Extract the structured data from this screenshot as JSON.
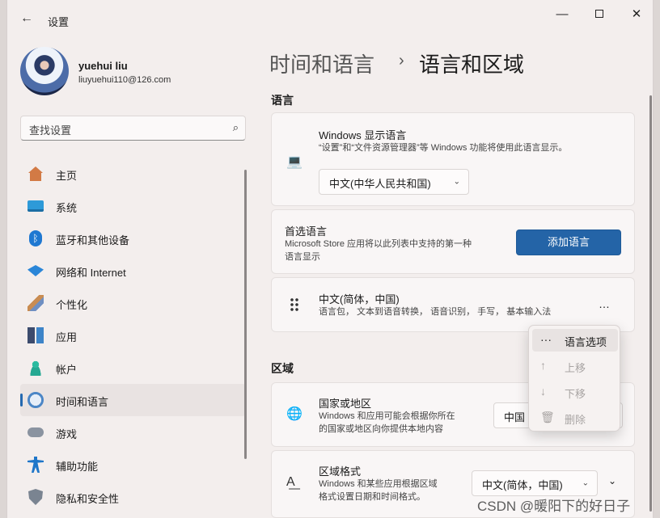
{
  "window": {
    "title": "设置",
    "back_icon": "back-arrow-icon"
  },
  "user": {
    "name": "yuehui liu",
    "email": "liuyuehui110@126.com"
  },
  "search": {
    "placeholder": "查找设置"
  },
  "nav": [
    {
      "label": "主页",
      "icon": "home-icon"
    },
    {
      "label": "系统",
      "icon": "system-icon"
    },
    {
      "label": "蓝牙和其他设备",
      "icon": "bluetooth-icon"
    },
    {
      "label": "网络和 Internet",
      "icon": "wifi-icon"
    },
    {
      "label": "个性化",
      "icon": "brush-icon"
    },
    {
      "label": "应用",
      "icon": "apps-icon"
    },
    {
      "label": "帐户",
      "icon": "account-icon"
    },
    {
      "label": "时间和语言",
      "icon": "time-language-icon",
      "active": true
    },
    {
      "label": "游戏",
      "icon": "gamepad-icon"
    },
    {
      "label": "辅助功能",
      "icon": "accessibility-icon"
    },
    {
      "label": "隐私和安全性",
      "icon": "shield-icon"
    }
  ],
  "breadcrumb": {
    "parent": "时间和语言",
    "separator": "›",
    "current": "语言和区域"
  },
  "language_section": {
    "heading": "语言",
    "display_language": {
      "title": "Windows 显示语言",
      "desc": "“设置”和“文件资源管理器”等 Windows 功能将使用此语言显示。",
      "value": "中文(中华人民共和国)"
    },
    "preferred": {
      "title": "首选语言",
      "desc_line1": "Microsoft Store 应用将以此列表中支持的第一种",
      "desc_line2": "语言显示",
      "button": "添加语言"
    },
    "language_item": {
      "title": "中文(简体，中国)",
      "desc": "语言包， 文本到语音转换， 语音识别， 手写， 基本输入法",
      "more": "…"
    }
  },
  "context_menu": {
    "items": [
      {
        "label": "语言选项",
        "icon": "ellipsis-icon",
        "glyph": "···"
      },
      {
        "label": "上移",
        "icon": "arrow-up-icon",
        "glyph": "↑"
      },
      {
        "label": "下移",
        "icon": "arrow-down-icon",
        "glyph": "↓"
      },
      {
        "label": "删除",
        "icon": "trash-icon",
        "glyph": "🗑"
      }
    ]
  },
  "region_section": {
    "heading": "区域",
    "country": {
      "title": "国家或地区",
      "desc_line1": "Windows 和应用可能会根据你所在",
      "desc_line2": "的国家或地区向你提供本地内容",
      "value": "中国"
    },
    "format": {
      "title": "区域格式",
      "desc_line1": "Windows 和某些应用根据区域",
      "desc_line2": "格式设置日期和时间格式。",
      "value": "中文(简体，中国)"
    }
  },
  "watermark": "CSDN @暖阳下的好日子",
  "colors": {
    "accent": "#2464a7",
    "window_bg": "#f3eeed",
    "card_bg": "#f9f6f6"
  }
}
